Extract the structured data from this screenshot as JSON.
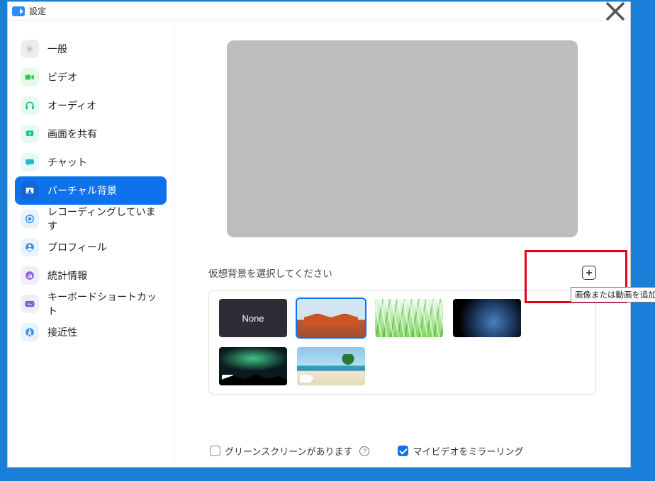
{
  "window": {
    "title": "設定"
  },
  "sidebar": {
    "items": [
      {
        "label": "一般"
      },
      {
        "label": "ビデオ"
      },
      {
        "label": "オーディオ"
      },
      {
        "label": "画面を共有"
      },
      {
        "label": "チャット"
      },
      {
        "label": "バーチャル背景"
      },
      {
        "label": "レコーディングしています"
      },
      {
        "label": "プロフィール"
      },
      {
        "label": "統計情報"
      },
      {
        "label": "キーボードショートカット"
      },
      {
        "label": "接近性"
      }
    ]
  },
  "main": {
    "choose_label": "仮想背景を選択してください",
    "none_label": "None",
    "add_tooltip": "画像または動画を追加"
  },
  "options": {
    "green_screen": "グリーンスクリーンがあります",
    "mirror": "マイビデオをミラーリング",
    "help": "?"
  }
}
